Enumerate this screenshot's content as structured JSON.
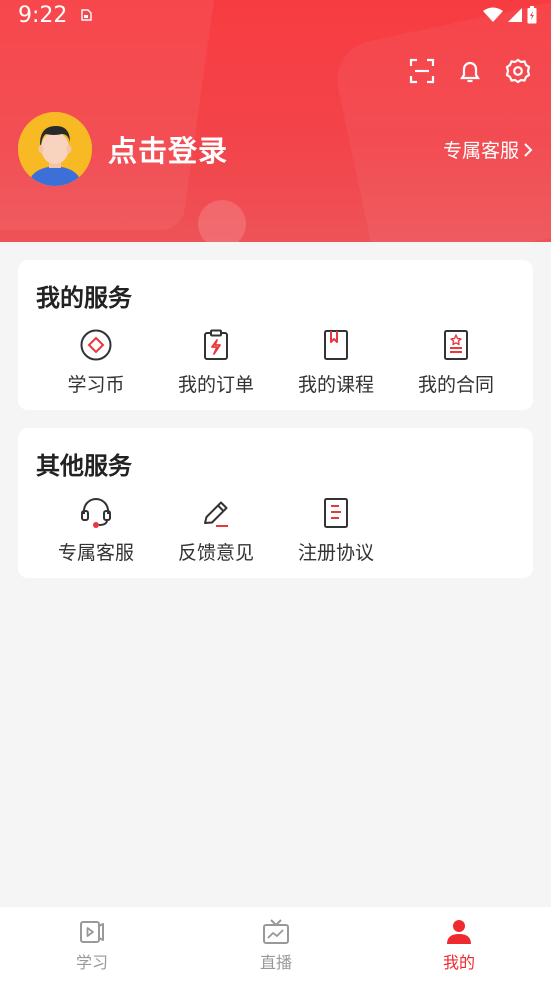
{
  "status_bar": {
    "time": "9:22"
  },
  "header": {
    "login_text": "点击登录",
    "customer_service_link": "专属客服"
  },
  "my_services": {
    "title": "我的服务",
    "items": [
      {
        "label": "学习币",
        "icon": "coin-icon"
      },
      {
        "label": "我的订单",
        "icon": "order-clipboard-icon"
      },
      {
        "label": "我的课程",
        "icon": "course-book-icon"
      },
      {
        "label": "我的合同",
        "icon": "contract-icon"
      }
    ]
  },
  "other_services": {
    "title": "其他服务",
    "items": [
      {
        "label": "专属客服",
        "icon": "headset-icon"
      },
      {
        "label": "反馈意见",
        "icon": "pencil-icon"
      },
      {
        "label": "注册协议",
        "icon": "agreement-doc-icon"
      }
    ]
  },
  "tabbar": {
    "items": [
      {
        "label": "学习",
        "icon": "play-video-icon",
        "active": false
      },
      {
        "label": "直播",
        "icon": "tv-live-icon",
        "active": false
      },
      {
        "label": "我的",
        "icon": "person-icon",
        "active": true
      }
    ]
  },
  "colors": {
    "accent": "#ee2a30",
    "header_top": "#f73c41",
    "icon_red": "#e8383d"
  }
}
